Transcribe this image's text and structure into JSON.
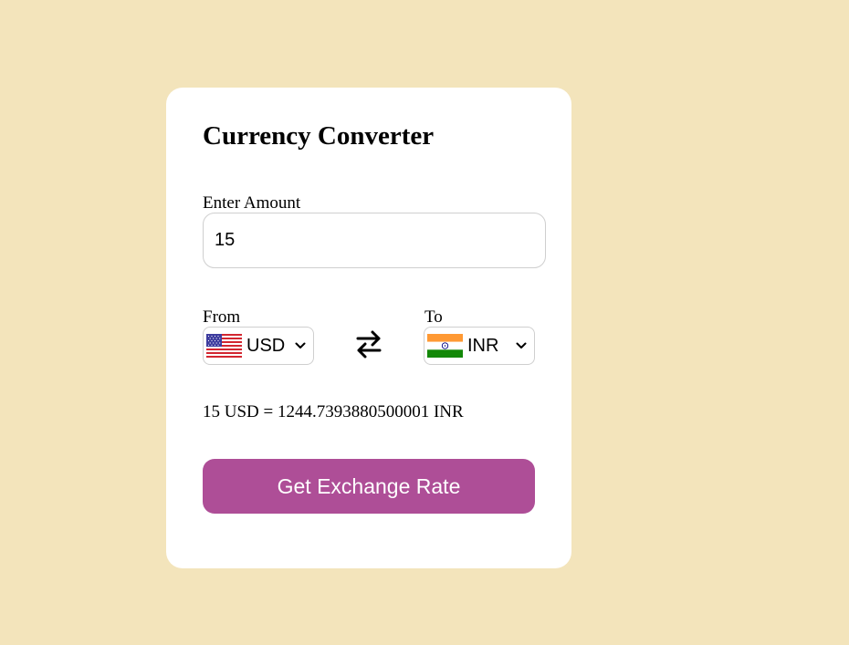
{
  "converter": {
    "title": "Currency Converter",
    "amount_label": "Enter Amount",
    "amount_value": "15",
    "from_label": "From",
    "from_currency": "USD",
    "from_flag": "us-flag-icon",
    "to_label": "To",
    "to_currency": "INR",
    "to_flag": "india-flag-icon",
    "swap_icon": "swap-arrows-icon",
    "result_text": "15 USD = 1244.7393880500001 INR",
    "button_label": "Get Exchange Rate"
  },
  "colors": {
    "page_background": "#f3e4bb",
    "card_background": "#ffffff",
    "button_background": "#ae4e97",
    "button_text": "#ffffff"
  }
}
